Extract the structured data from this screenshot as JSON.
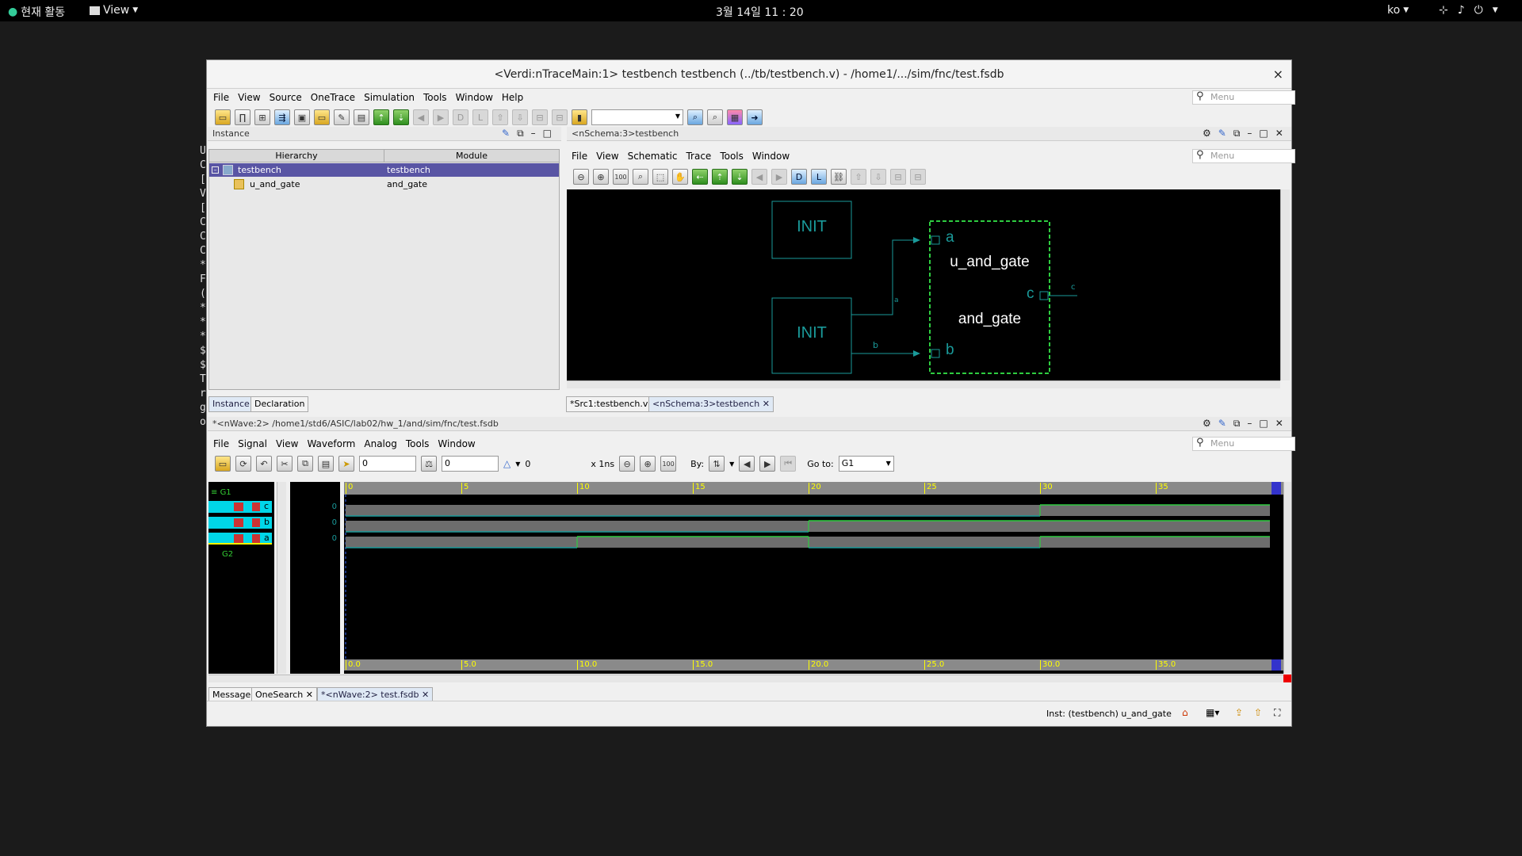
{
  "topbar": {
    "activities": "현재 활동",
    "view_menu": "View",
    "clock": "3월 14일  11 : 20",
    "lang": "ko"
  },
  "terminal_fragments": [
    "U",
    "C",
    "[",
    "V",
    "[",
    "C",
    "C",
    "C",
    "*",
    "F",
    "(",
    "*",
    "*",
    "*",
    "$",
    "$",
    "T",
    "r",
    "g",
    "o"
  ],
  "window": {
    "title": "<Verdi:nTraceMain:1> testbench testbench (../tb/testbench.v) - /home1/.../sim/fnc/test.fsdb",
    "close_label": "×",
    "menu": [
      "File",
      "View",
      "Source",
      "OneTrace",
      "Simulation",
      "Tools",
      "Window",
      "Help"
    ],
    "menu_search_placeholder": "Menu"
  },
  "instance_panel": {
    "title": "Instance",
    "col_hierarchy": "Hierarchy",
    "col_module": "Module",
    "rows": [
      {
        "name": "testbench",
        "module": "testbench",
        "selected": true
      },
      {
        "name": "u_and_gate",
        "module": "and_gate",
        "selected": false
      }
    ],
    "tabs": [
      "Instance",
      "Declaration"
    ]
  },
  "schema_panel": {
    "title": "<nSchema:3>testbench",
    "menu": [
      "File",
      "View",
      "Schematic",
      "Trace",
      "Tools",
      "Window"
    ],
    "menu_search_placeholder": "Menu",
    "init_top_label": "INIT",
    "init_bottom_label": "INIT",
    "gate_instance": "u_and_gate",
    "gate_module": "and_gate",
    "port_a": "a",
    "port_b": "b",
    "port_c": "c",
    "net_a": "a",
    "net_b": "b",
    "net_c": "c",
    "tabs": [
      "*Src1:testbench.v",
      "<nSchema:3>testbench"
    ]
  },
  "wave_panel": {
    "title": "*<nWave:2> /home1/std6/ASIC/lab02/hw_1/and/sim/fnc/test.fsdb",
    "menu": [
      "File",
      "Signal",
      "View",
      "Waveform",
      "Analog",
      "Tools",
      "Window"
    ],
    "menu_search_placeholder": "Menu",
    "cursor_value": "0",
    "marker_value": "0",
    "delta_value": "0",
    "time_unit": "x 1ns",
    "by_label": "By:",
    "goto_label": "Go to:",
    "goto_value": "G1",
    "groups": [
      "G1",
      "G2"
    ],
    "signals": [
      {
        "name": "c",
        "value": "0"
      },
      {
        "name": "b",
        "value": "0"
      },
      {
        "name": "a",
        "value": "0"
      }
    ],
    "top_ticks": [
      "0",
      "5",
      "10",
      "15",
      "20",
      "25",
      "30",
      "35"
    ],
    "bottom_ticks": [
      "0.0",
      "5.0",
      "10.0",
      "15.0",
      "20.0",
      "25.0",
      "30.0",
      "35.0"
    ],
    "tabs": [
      "Message",
      "OneSearch",
      "*<nWave:2> test.fsdb"
    ]
  },
  "status": {
    "inst_text": "Inst: (testbench) u_and_gate"
  }
}
